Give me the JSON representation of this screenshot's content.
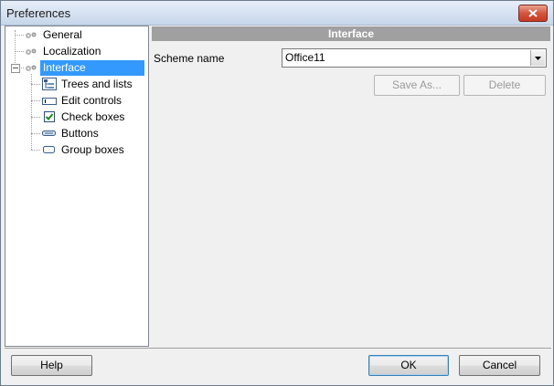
{
  "window": {
    "title": "Preferences"
  },
  "tree": {
    "items": [
      {
        "label": "General",
        "icon": "gear-icon"
      },
      {
        "label": "Localization",
        "icon": "gear-icon"
      },
      {
        "label": "Interface",
        "icon": "gear-icon",
        "selected": true,
        "expanded": true
      },
      {
        "label": "Trees and lists",
        "icon": "tree-icon"
      },
      {
        "label": "Edit controls",
        "icon": "edit-control-icon"
      },
      {
        "label": "Check boxes",
        "icon": "checkbox-icon"
      },
      {
        "label": "Buttons",
        "icon": "button-icon"
      },
      {
        "label": "Group boxes",
        "icon": "groupbox-icon"
      }
    ]
  },
  "panel": {
    "header": "Interface",
    "scheme_label": "Scheme name",
    "scheme_value": "Office11",
    "save_as_label": "Save As...",
    "delete_label": "Delete"
  },
  "footer": {
    "help_label": "Help",
    "ok_label": "OK",
    "cancel_label": "Cancel"
  },
  "colors": {
    "selection": "#3399ff",
    "header_bg": "#a0a0a0"
  }
}
